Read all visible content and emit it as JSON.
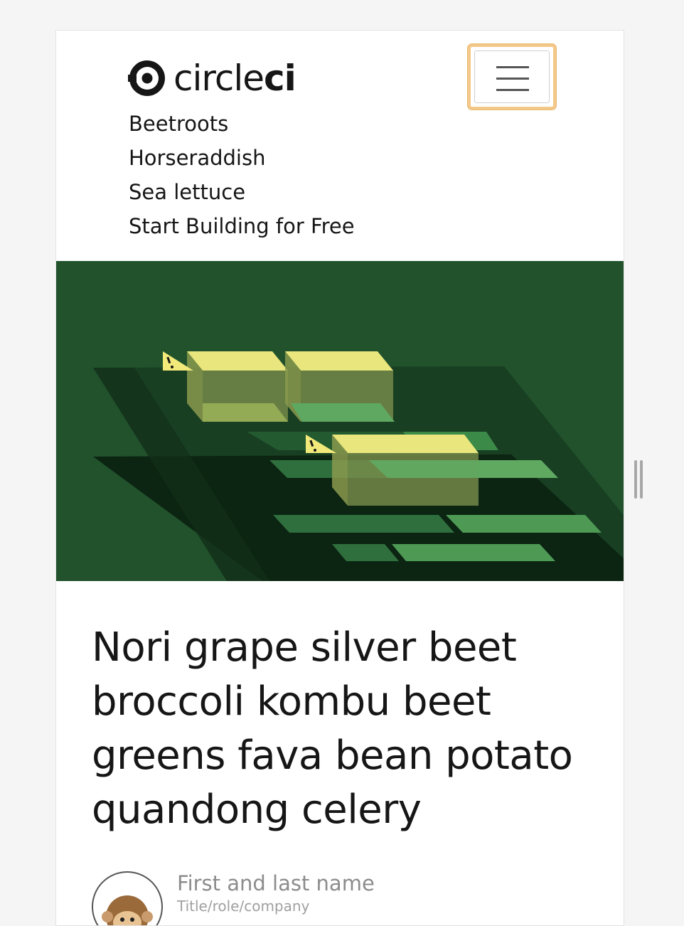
{
  "brand": {
    "logo_regular": "circle",
    "logo_bold": "ci",
    "logo_icon": "circleci-logo-icon"
  },
  "header": {
    "menu_icon": "hamburger-menu-icon"
  },
  "nav": {
    "items": [
      {
        "label": "Beetroots"
      },
      {
        "label": "Horseraddish"
      },
      {
        "label": "Sea lettuce"
      },
      {
        "label": "Start Building for Free"
      }
    ]
  },
  "hero": {
    "illustration": "pipeline-blocks-illustration",
    "warning_icon": "warning-icon"
  },
  "article": {
    "title": "Nori grape silver beet broccoli kombu beet greens fava bean potato quandong celery",
    "author": {
      "name": "First and last name",
      "role": "Title/role/company",
      "avatar_icon": "monkey-avatar-icon"
    }
  },
  "colors": {
    "text": "#161616",
    "hero_bg": "#21522c",
    "focus_ring": "#f3c989",
    "muted": "#8c8c8c"
  }
}
